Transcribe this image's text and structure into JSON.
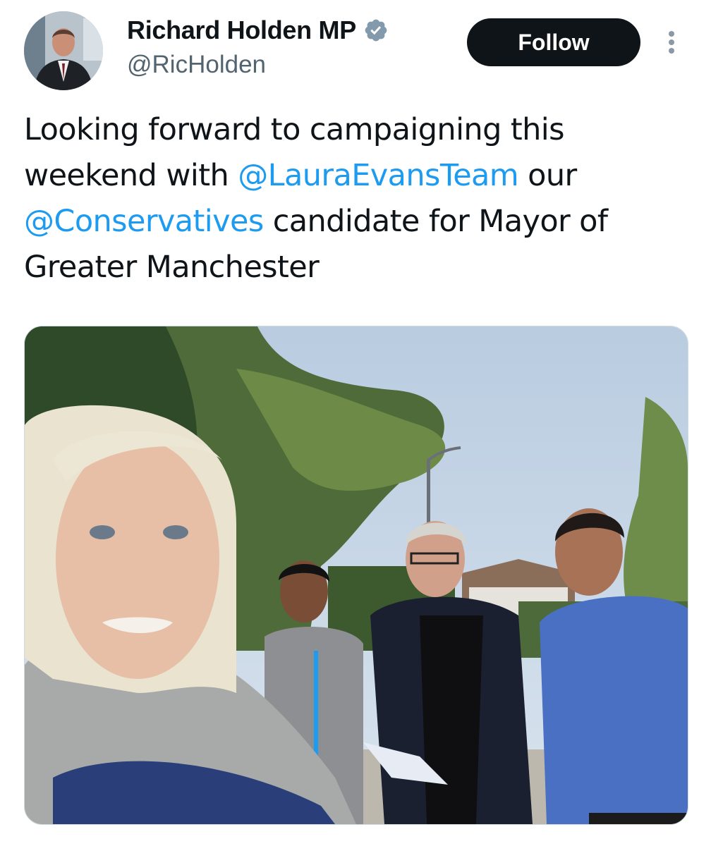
{
  "author": {
    "display_name": "Richard Holden MP",
    "handle": "@RicHolden",
    "verified_icon": "verified-badge-icon",
    "avatar_icon": "profile-photo"
  },
  "actions": {
    "follow_label": "Follow",
    "more_icon": "more-vertical-icon"
  },
  "tweet": {
    "text_1": "Looking forward to campaigning this weekend with ",
    "mention_1": "@LauraEvansTeam",
    "text_2": " our ",
    "mention_2": "@Conservatives",
    "text_3": " candidate for Mayor of Greater Manchester"
  },
  "media": {
    "type": "photo",
    "icon": "photo-image"
  },
  "colors": {
    "link": "#1d9bf0",
    "button_bg": "#0f1419",
    "secondary_text": "#536471",
    "verified_badge": "#829aab"
  }
}
